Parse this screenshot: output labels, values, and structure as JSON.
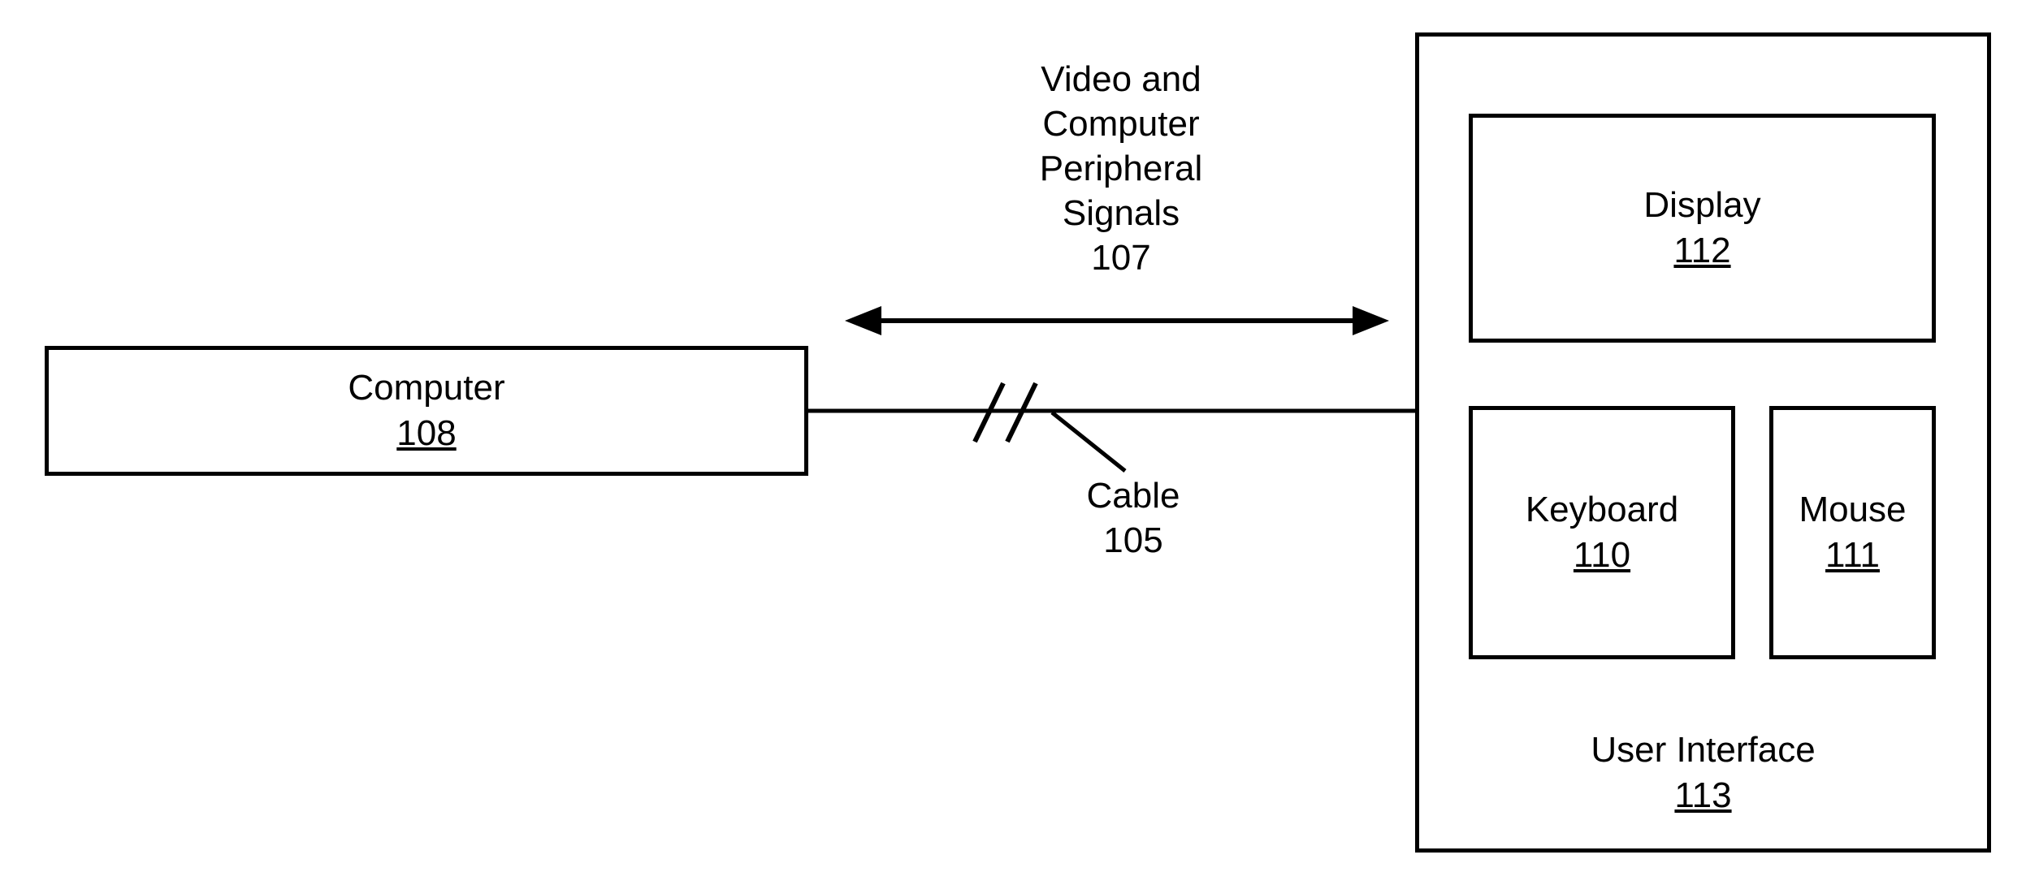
{
  "diagram": {
    "signals": {
      "line1": "Video and",
      "line2": "Computer",
      "line3": "Peripheral",
      "line4": "Signals",
      "num": "107"
    },
    "computer": {
      "title": "Computer",
      "num": "108"
    },
    "cable": {
      "title": "Cable",
      "num": "105"
    },
    "user_interface": {
      "title": "User Interface",
      "num": "113"
    },
    "display": {
      "title": "Display",
      "num": "112"
    },
    "keyboard": {
      "title": "Keyboard",
      "num": "110"
    },
    "mouse": {
      "title": "Mouse",
      "num": "111"
    }
  }
}
